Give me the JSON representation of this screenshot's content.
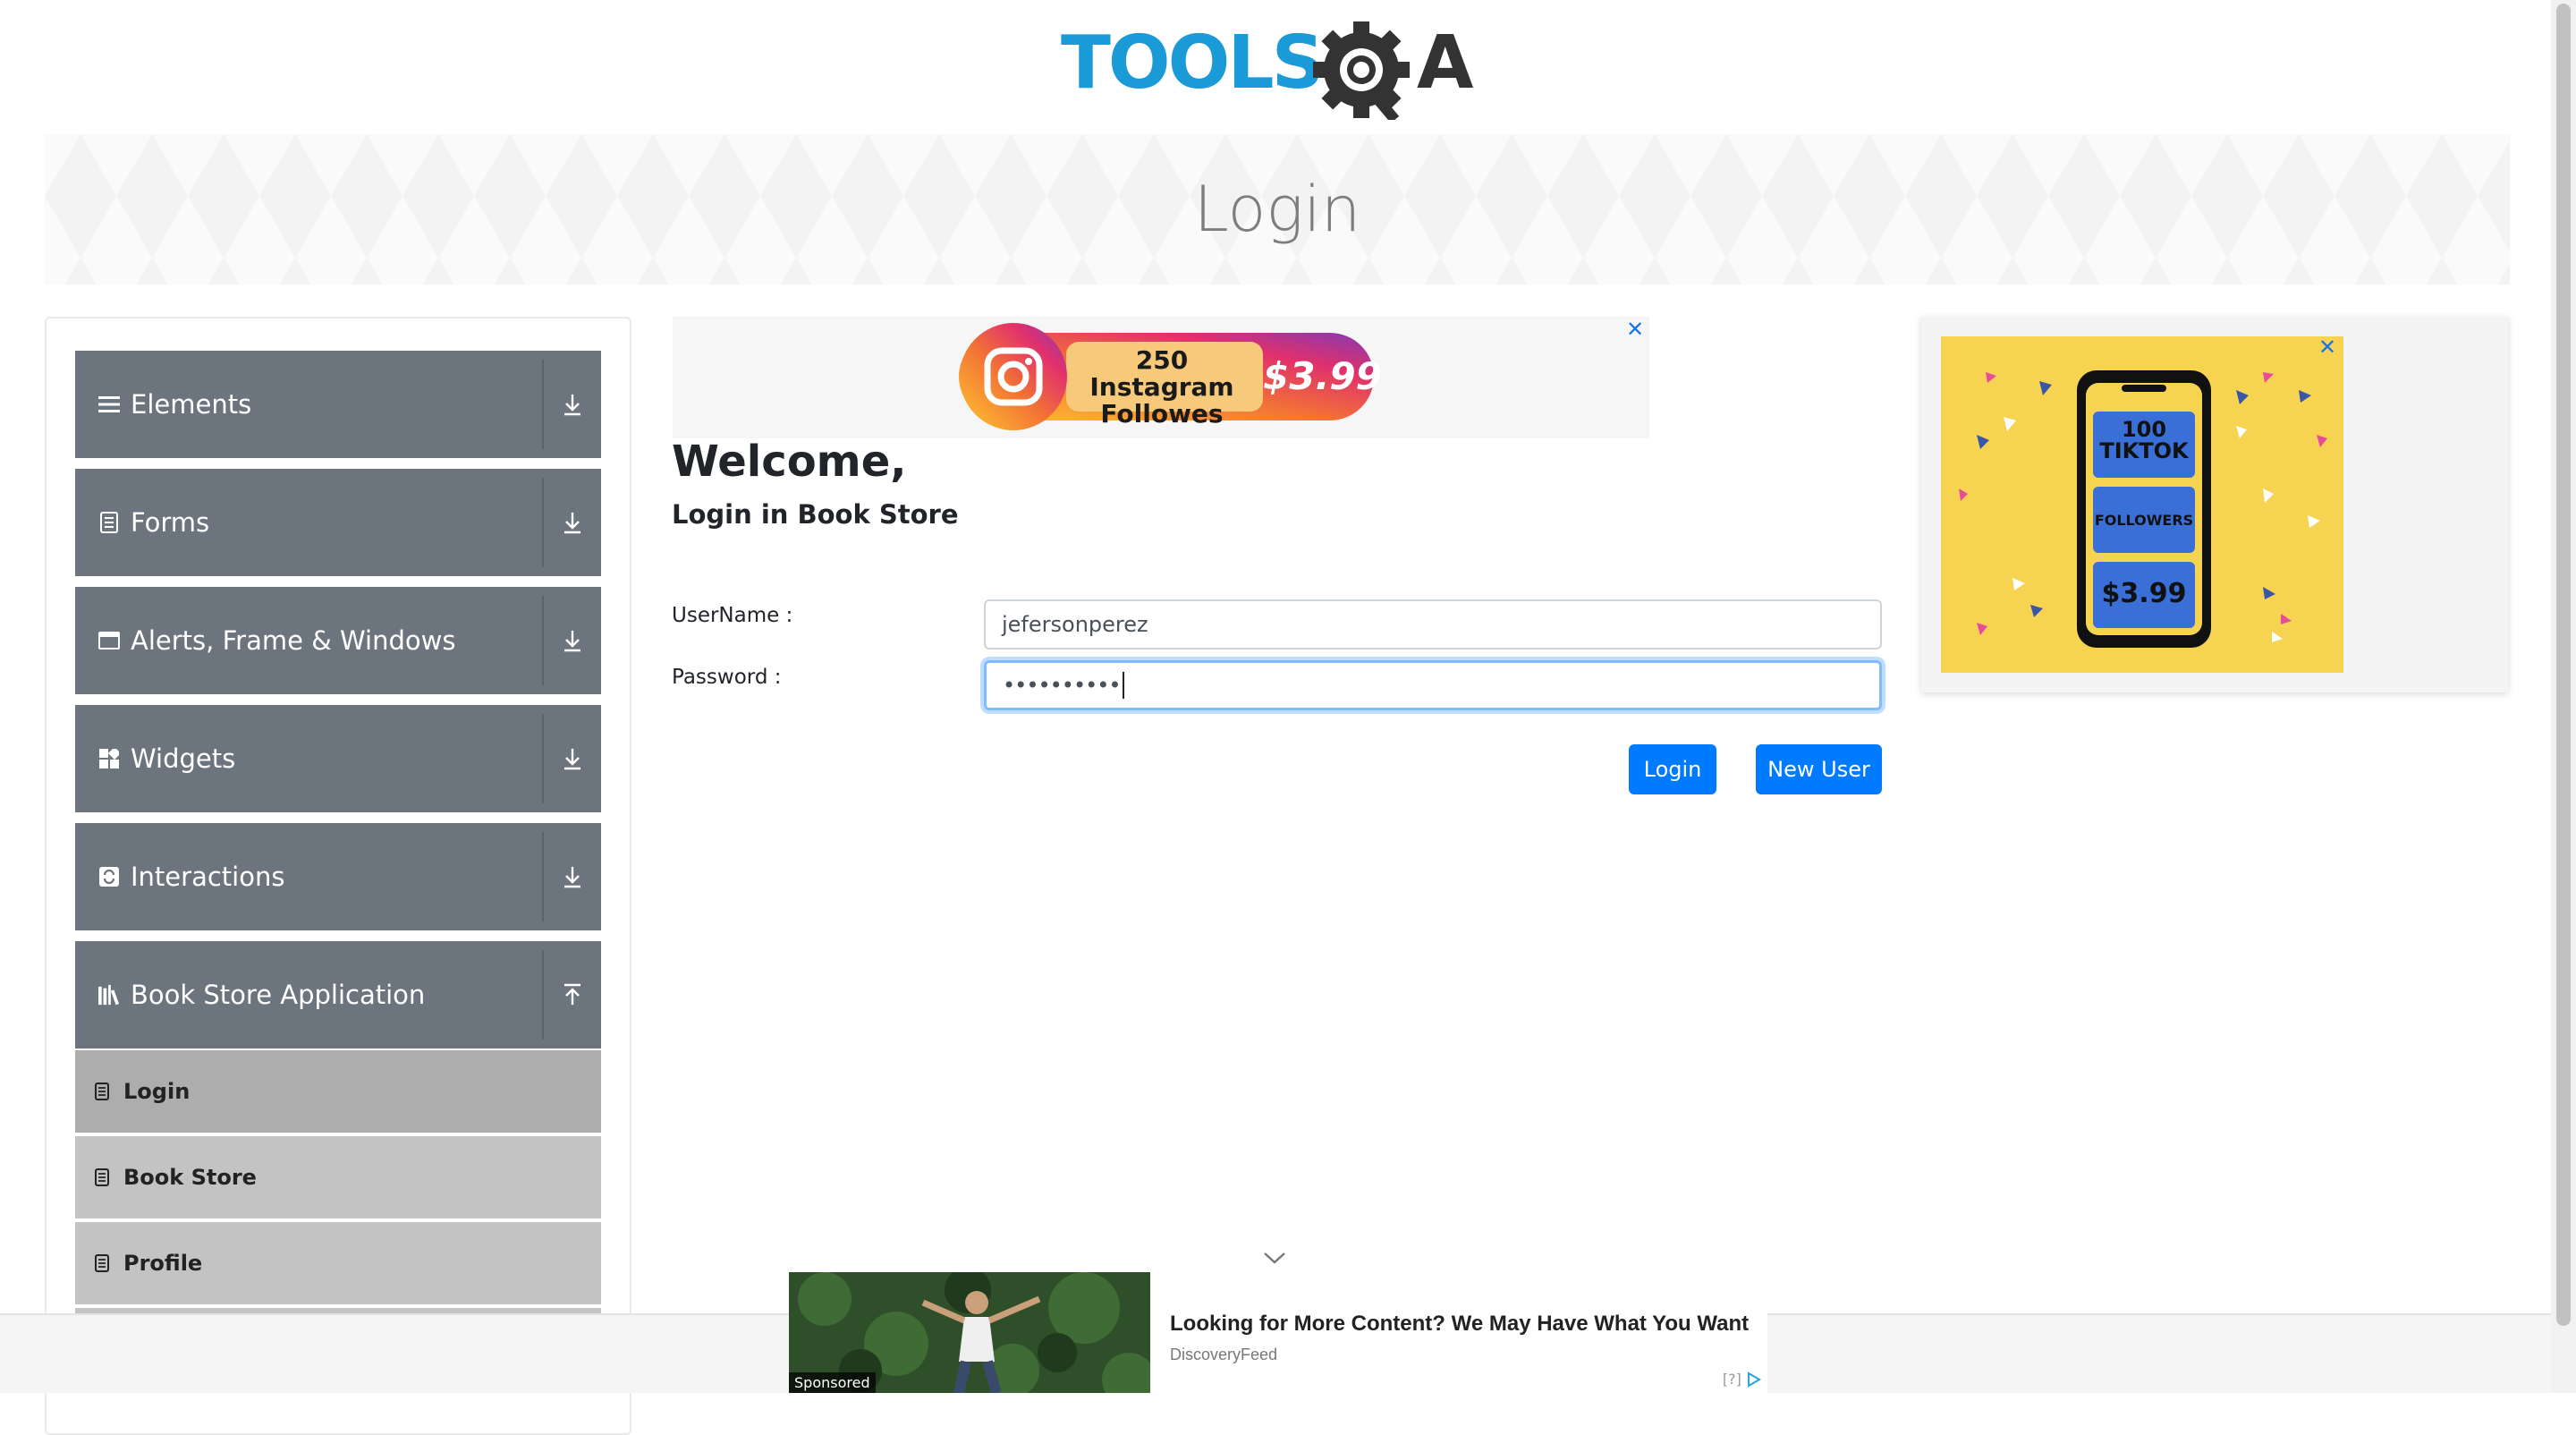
{
  "header": {
    "logo_text_left": "TOOLS",
    "logo_text_right": "A"
  },
  "banner": {
    "title": "Login"
  },
  "sidebar": {
    "groups": [
      {
        "label": "Elements",
        "icon": "list-icon"
      },
      {
        "label": "Forms",
        "icon": "form-icon"
      },
      {
        "label": "Alerts, Frame & Windows",
        "icon": "window-icon"
      },
      {
        "label": "Widgets",
        "icon": "widgets-icon"
      },
      {
        "label": "Interactions",
        "icon": "interactions-icon"
      },
      {
        "label": "Book Store Application",
        "icon": "books-icon"
      }
    ],
    "book_store_items": [
      {
        "label": "Login",
        "active": true
      },
      {
        "label": "Book Store"
      },
      {
        "label": "Profile"
      }
    ]
  },
  "ad_top": {
    "line1": "250 Instagram",
    "line2": "Followes",
    "price": "$3.99"
  },
  "main": {
    "welcome": "Welcome,",
    "subtitle": "Login in Book Store",
    "username_label": "UserName :",
    "password_label": "Password :",
    "username_value": "jefersonperez",
    "password_value": "••••••••••",
    "login_button": "Login",
    "new_user_button": "New User"
  },
  "ad_right": {
    "line1": "100",
    "line2": "TIKTOK",
    "line3": "FOLLOWERS",
    "price": "$3.99"
  },
  "sponsored": {
    "tag": "Sponsored",
    "title": "Looking for More Content? We May Have What You Want",
    "source": "DiscoveryFeed",
    "ad_marker": "[?]"
  },
  "colors": {
    "accent": "#007bff",
    "sidebar_group": "#6c757d",
    "sidebar_item": "#c3c3c3",
    "logo_blue": "#1a9ad6",
    "logo_dark": "#333333"
  }
}
